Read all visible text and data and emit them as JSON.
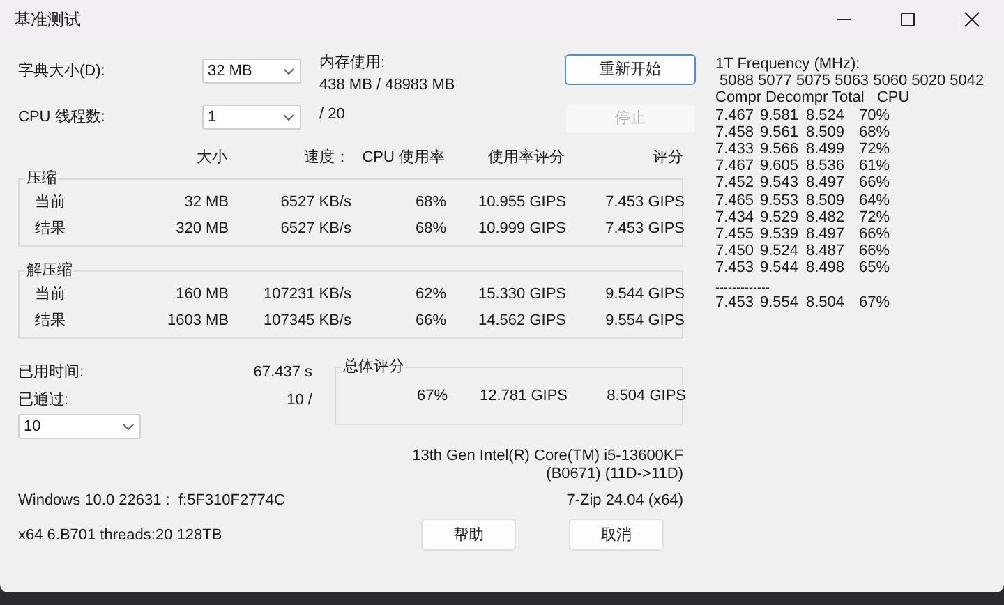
{
  "window": {
    "title": "基准测试"
  },
  "settings": {
    "dictionary": {
      "label": "字典大小(D):",
      "value": "32 MB"
    },
    "threads": {
      "label": "CPU 线程数:",
      "value": "1",
      "max": "/ 20"
    },
    "memory": {
      "label": "内存使用:",
      "value": "438 MB / 48983 MB"
    }
  },
  "action_buttons": [
    {
      "label": "重新开始",
      "disabled": false,
      "focused": true
    },
    {
      "label": "停止",
      "disabled": true,
      "focused": false
    }
  ],
  "table": {
    "columns": [
      "大小",
      "速度：",
      "CPU 使用率",
      "使用率评分",
      "评分"
    ],
    "groups": [
      {
        "title": "压缩",
        "rows": [
          {
            "label": "当前",
            "cells": [
              "32 MB",
              "6527 KB/s",
              "68%",
              "10.955 GIPS",
              "7.453 GIPS"
            ]
          },
          {
            "label": "结果",
            "cells": [
              "320 MB",
              "6527 KB/s",
              "68%",
              "10.999 GIPS",
              "7.453 GIPS"
            ]
          }
        ]
      },
      {
        "title": "解压缩",
        "rows": [
          {
            "label": "当前",
            "cells": [
              "160 MB",
              "107231 KB/s",
              "62%",
              "15.330 GIPS",
              "9.544 GIPS"
            ]
          },
          {
            "label": "结果",
            "cells": [
              "1603 MB",
              "107345 KB/s",
              "66%",
              "14.562 GIPS",
              "9.554 GIPS"
            ]
          }
        ]
      }
    ]
  },
  "elapsed": {
    "label": "已用时间:",
    "value": "67.437 s"
  },
  "passes": {
    "label": "已通过:",
    "value": "10 /",
    "select_value": "10"
  },
  "total": {
    "title": "总体评分",
    "cells": [
      "67%",
      "12.781 GIPS",
      "8.504 GIPS"
    ]
  },
  "cpu_info": [
    "13th Gen Intel(R) Core(TM) i5-13600KF",
    "(B0671) (11D->11D)"
  ],
  "os_info": "Windows 10.0 22631 :  f:5F310F2774C",
  "version": "7-Zip 24.04 (x64)",
  "system_info": "x64 6.B701 threads:20 128TB",
  "dialog_buttons": [
    "帮助",
    "取消"
  ],
  "log": {
    "title": "1T Frequency (MHz):",
    "frequencies": "5088 5077 5075 5063 5060 5020 5042",
    "header": "Compr Decompr Total   CPU",
    "rows": [
      [
        "7.467",
        "9.581",
        "8.524",
        "70%"
      ],
      [
        "7.458",
        "9.561",
        "8.509",
        "68%"
      ],
      [
        "7.433",
        "9.566",
        "8.499",
        "72%"
      ],
      [
        "7.467",
        "9.605",
        "8.536",
        "61%"
      ],
      [
        "7.452",
        "9.543",
        "8.497",
        "66%"
      ],
      [
        "7.465",
        "9.553",
        "8.509",
        "64%"
      ],
      [
        "7.434",
        "9.529",
        "8.482",
        "72%"
      ],
      [
        "7.455",
        "9.539",
        "8.497",
        "66%"
      ],
      [
        "7.450",
        "9.524",
        "8.487",
        "66%"
      ],
      [
        "7.453",
        "9.544",
        "8.498",
        "65%"
      ]
    ],
    "separator": "-------------",
    "summary": [
      "7.453",
      "9.554",
      "8.504",
      "67%"
    ]
  }
}
